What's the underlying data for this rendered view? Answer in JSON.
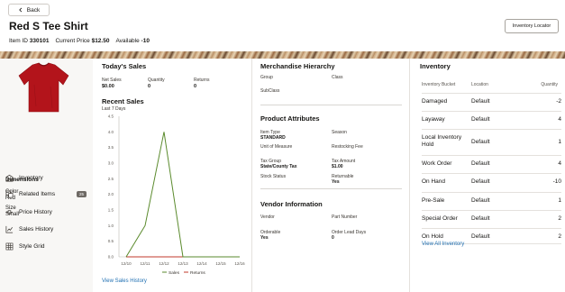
{
  "header": {
    "back_label": "Back",
    "title": "Red S Tee Shirt",
    "item_id_label": "Item ID",
    "item_id": "330101",
    "current_price_label": "Current Price",
    "current_price": "$12.50",
    "available_label": "Available",
    "available": "-10",
    "inventory_locator_label": "Inventory Locator"
  },
  "sidebar": {
    "dimensions_title": "Dimensions",
    "color_label": "Color",
    "color_value": "Red",
    "size_label": "Size",
    "size_value": "Small",
    "nav": [
      {
        "label": "Inventory",
        "icon": "warehouse-icon"
      },
      {
        "label": "Related Items",
        "icon": "related-items-icon",
        "badge": "25"
      },
      {
        "label": "Price History",
        "icon": "price-history-icon"
      },
      {
        "label": "Sales History",
        "icon": "sales-history-icon"
      },
      {
        "label": "Style Grid",
        "icon": "grid-icon"
      }
    ]
  },
  "todays_sales": {
    "title": "Today's Sales",
    "net_sales_label": "Net Sales",
    "net_sales": "$0.00",
    "quantity_label": "Quantity",
    "quantity": "0",
    "returns_label": "Returns",
    "returns": "0"
  },
  "recent_sales": {
    "title": "Recent Sales",
    "subtitle": "Last 7 Days",
    "link": "View Sales History"
  },
  "chart_data": {
    "type": "line",
    "title": "Recent Sales",
    "subtitle": "Last 7 Days",
    "categories": [
      "12/10",
      "12/11",
      "12/12",
      "12/13",
      "12/14",
      "12/15",
      "12/16"
    ],
    "ylim": [
      0,
      4.5
    ],
    "yticks": [
      "4.5",
      "4.0",
      "3.5",
      "3.0",
      "2.5",
      "2.0",
      "1.5",
      "1.0",
      "0.5",
      "0.0"
    ],
    "series": [
      {
        "name": "Sales",
        "color": "#5a8a2c",
        "values": [
          0,
          1,
          4,
          0,
          0,
          0,
          0
        ]
      },
      {
        "name": "Returns",
        "color": "#c0392b",
        "values": [
          0,
          0,
          0,
          0,
          0,
          0,
          0
        ]
      }
    ],
    "legend_position": "bottom"
  },
  "merchandise": {
    "title": "Merchandise Hierarchy",
    "group_label": "Group",
    "class_label": "Class",
    "subclass_label": "SubClass"
  },
  "attributes": {
    "title": "Product Attributes",
    "item_type_label": "Item Type",
    "item_type": "STANDARD",
    "season_label": "Season",
    "uom_label": "Unit of Measure",
    "restocking_label": "Restocking Fee",
    "tax_group_label": "Tax Group",
    "tax_group": "State/County Tax",
    "tax_amount_label": "Tax Amount",
    "tax_amount": "$1.00",
    "stock_status_label": "Stock Status",
    "returnable_label": "Returnable",
    "returnable": "Yes"
  },
  "vendor": {
    "title": "Vendor Information",
    "vendor_label": "Vendor",
    "part_number_label": "Part Number",
    "orderable_label": "Orderable",
    "orderable": "Yes",
    "lead_days_label": "Order Lead Days",
    "lead_days": "0"
  },
  "inventory": {
    "title": "Inventory",
    "col_bucket": "Inventory Bucket",
    "col_location": "Location",
    "col_quantity": "Quantity",
    "rows": [
      {
        "bucket": "Damaged",
        "location": "Default",
        "qty": "-2"
      },
      {
        "bucket": "Layaway",
        "location": "Default",
        "qty": "4"
      },
      {
        "bucket": "Local Inventory Hold",
        "location": "Default",
        "qty": "1"
      },
      {
        "bucket": "Work Order",
        "location": "Default",
        "qty": "4"
      },
      {
        "bucket": "On Hand",
        "location": "Default",
        "qty": "-10"
      },
      {
        "bucket": "Pre-Sale",
        "location": "Default",
        "qty": "1"
      },
      {
        "bucket": "Special Order",
        "location": "Default",
        "qty": "2"
      },
      {
        "bucket": "On Hold",
        "location": "Default",
        "qty": "2"
      }
    ],
    "link": "View All Inventory"
  }
}
